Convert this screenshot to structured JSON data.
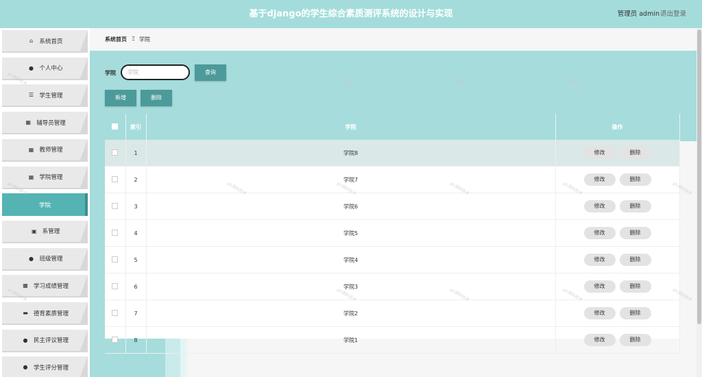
{
  "header": {
    "title": "基于django的学生综合素质测评系统的设计与实现",
    "user": "管理员 admin",
    "logout": "退出登录"
  },
  "sidebar": {
    "items": [
      {
        "label": "系统首页",
        "icon": "home-icon",
        "glyph": "⌂"
      },
      {
        "label": "个人中心",
        "icon": "user-icon",
        "glyph": "●"
      },
      {
        "label": "学生管理",
        "icon": "sliders-icon",
        "glyph": "☰"
      },
      {
        "label": "辅导员管理",
        "icon": "grid-icon",
        "glyph": "▦"
      },
      {
        "label": "教师管理",
        "icon": "grid-icon",
        "glyph": "▦"
      },
      {
        "label": "学院管理",
        "icon": "grid-icon",
        "glyph": "▦"
      },
      {
        "label": "学院",
        "icon": "",
        "glyph": "",
        "active": true
      },
      {
        "label": "系管理",
        "icon": "clipboard-icon",
        "glyph": "▣"
      },
      {
        "label": "班级管理",
        "icon": "pin-icon",
        "glyph": "●"
      },
      {
        "label": "学习成绩管理",
        "icon": "grid-icon",
        "glyph": "▦"
      },
      {
        "label": "德育素质管理",
        "icon": "message-icon",
        "glyph": "▬"
      },
      {
        "label": "民主评议管理",
        "icon": "user-icon",
        "glyph": "●"
      },
      {
        "label": "学生评分管理",
        "icon": "user-icon",
        "glyph": "●"
      }
    ]
  },
  "breadcrumb": {
    "home": "系统首页",
    "separator": "Ξ",
    "current": "学院"
  },
  "search": {
    "label": "学院",
    "placeholder": "学院",
    "button": "查询"
  },
  "actions": {
    "add": "新增",
    "delete": "删除"
  },
  "table": {
    "columns": [
      "索引",
      "学院",
      "操作"
    ],
    "rows": [
      {
        "index": "1",
        "name": "学院8",
        "selected": true
      },
      {
        "index": "2",
        "name": "学院7"
      },
      {
        "index": "3",
        "name": "学院6"
      },
      {
        "index": "4",
        "name": "学院5"
      },
      {
        "index": "5",
        "name": "学院4"
      },
      {
        "index": "6",
        "name": "学院3"
      },
      {
        "index": "7",
        "name": "学院2"
      },
      {
        "index": "8",
        "name": "学院1"
      }
    ],
    "row_actions": {
      "edit": "修改",
      "delete": "删除"
    }
  },
  "colors": {
    "header": "#a4dcdc",
    "accent": "#4d9a9a",
    "active_menu": "#55b3b3"
  }
}
